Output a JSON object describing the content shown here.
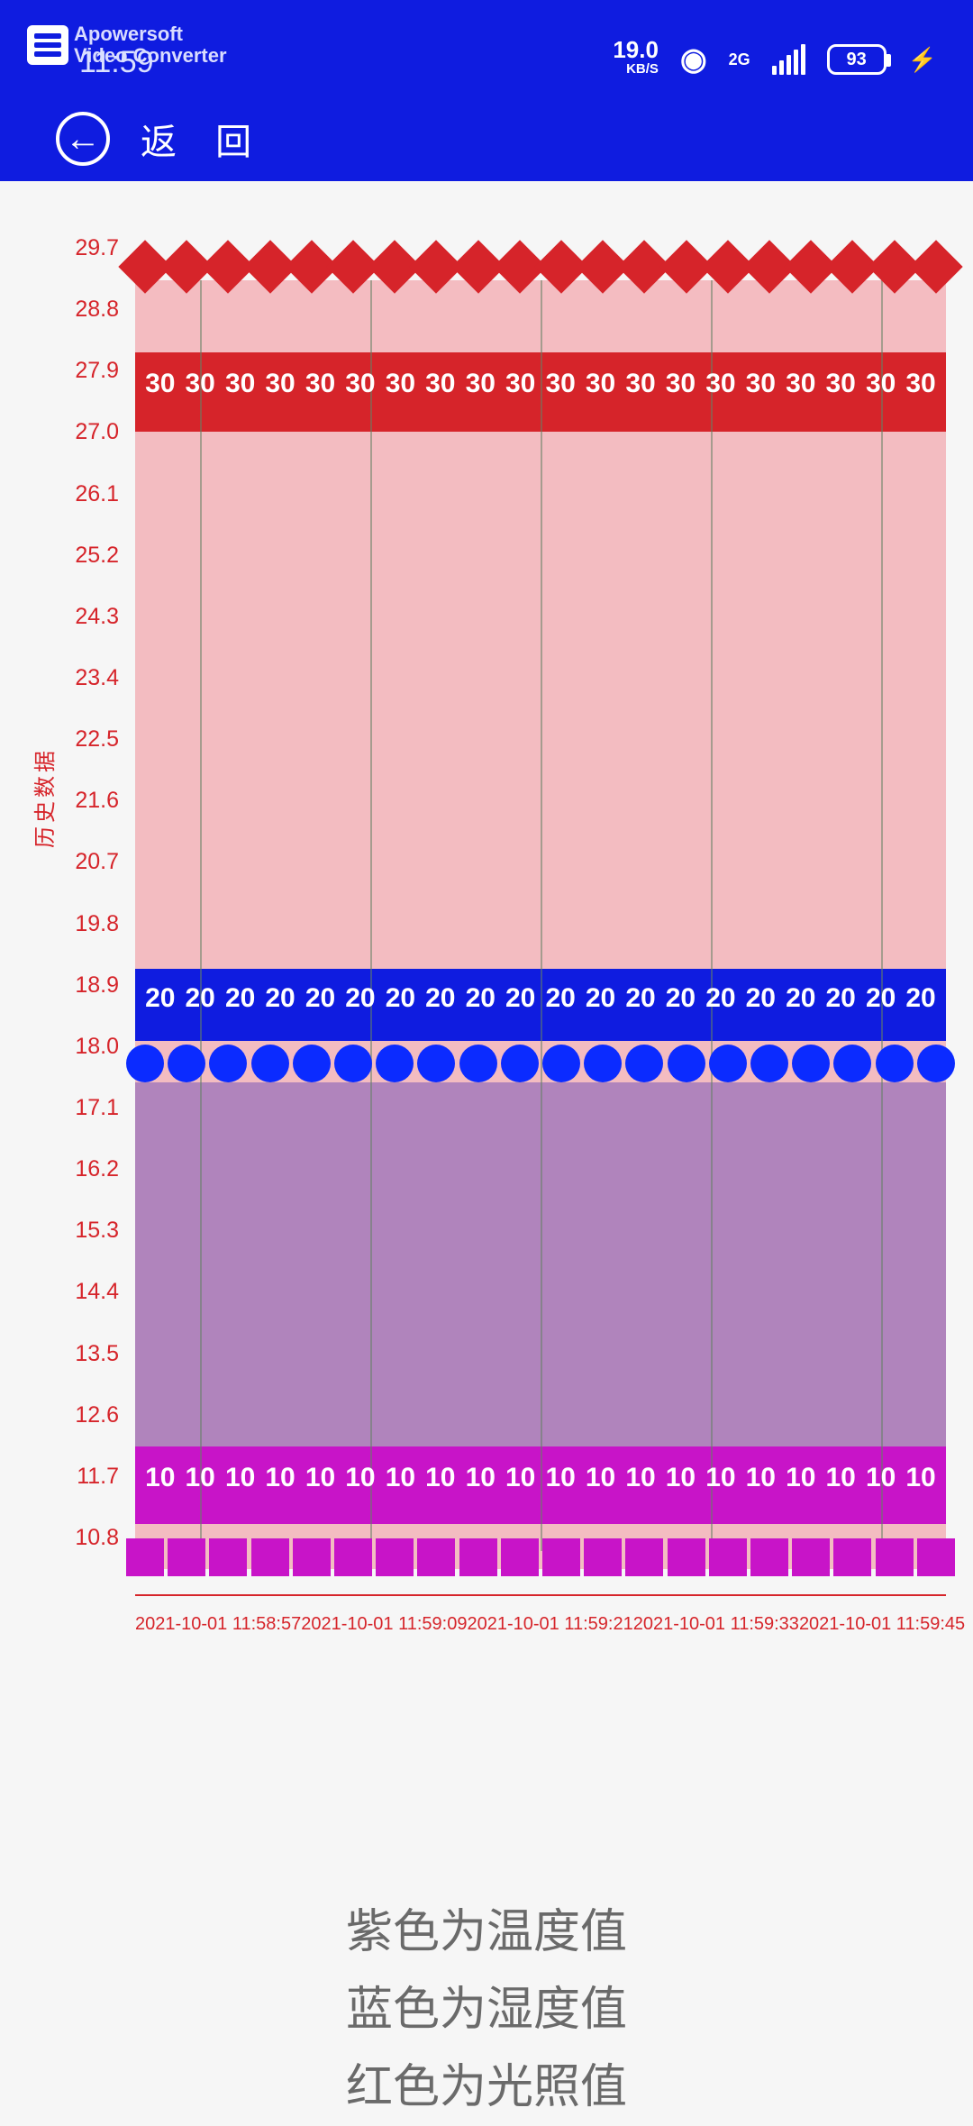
{
  "status": {
    "time": "11:59",
    "speed": "19.0",
    "speed_unit": "KB/S",
    "net": "2G",
    "battery": "93"
  },
  "watermark": {
    "l1": "Apowersoft",
    "l2": "Video Converter"
  },
  "nav": {
    "back_label": "返 回"
  },
  "legend": {
    "l1": "紫色为温度值",
    "l2": "蓝色为湿度值",
    "l3": "红色为光照值"
  },
  "chart_data": {
    "type": "area",
    "title": "",
    "ylabel": "历史数据",
    "xlabel": "",
    "ylim": [
      10.8,
      29.7
    ],
    "y_ticks": [
      "29.7",
      "28.8",
      "27.9",
      "27.0",
      "26.1",
      "25.2",
      "24.3",
      "23.4",
      "22.5",
      "21.6",
      "20.7",
      "19.8",
      "18.9",
      "18.0",
      "17.1",
      "16.2",
      "15.3",
      "14.4",
      "13.5",
      "12.6",
      "11.7",
      "10.8"
    ],
    "x_ticks": [
      "2021-10-01  11:58:57",
      "2021-10-01  11:59:09",
      "2021-10-01  11:59:21",
      "2021-10-01  11:59:33",
      "2021-10-01  11:59:45"
    ],
    "data_point_count": 20,
    "series": [
      {
        "name": "光照值",
        "color": "red",
        "marker": "diamond",
        "constant_value": 30,
        "label_text": "30"
      },
      {
        "name": "湿度值",
        "color": "blue",
        "marker": "circle",
        "constant_value": 20,
        "label_text": "20"
      },
      {
        "name": "温度值",
        "color": "magenta",
        "marker": "square",
        "constant_value": 10,
        "label_text": "10"
      }
    ]
  }
}
